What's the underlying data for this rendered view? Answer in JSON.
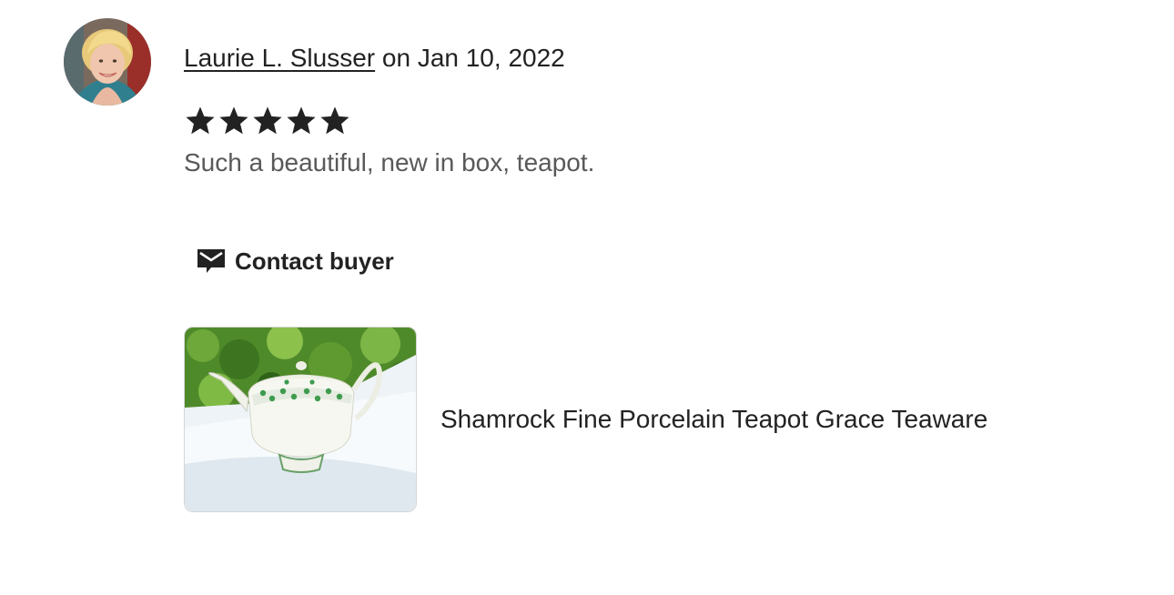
{
  "review": {
    "reviewer_name": "Laurie L. Slusser",
    "date_text": "on Jan 10, 2022",
    "rating": 5,
    "rating_max": 5,
    "text": "Such a beautiful, new in box, teapot.",
    "contact_label": "Contact buyer",
    "contact_icon": "envelope-chat-icon",
    "listing_title": "Shamrock Fine Porcelain Teapot Grace Teaware"
  },
  "colors": {
    "text_primary": "#222222",
    "text_secondary": "#595959",
    "star": "#222222"
  }
}
